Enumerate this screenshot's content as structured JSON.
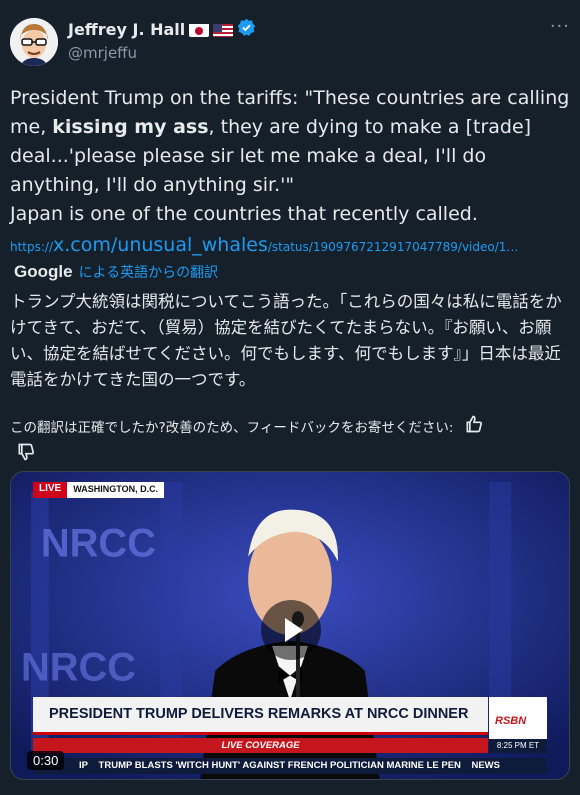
{
  "author": {
    "name": "Jeffrey J. Hall",
    "handle": "@mrjeffu",
    "flags": [
      "japan-flag",
      "usa-flag"
    ],
    "verified": true
  },
  "tweet": {
    "text_before_bold": "President Trump on the tariffs: \"These countries are calling me, ",
    "bold": "kissing my ass",
    "text_after_bold": ", they are dying to make a [trade] deal...'please please sir let me make a deal, I'll do anything, I'll do anything sir.'\"",
    "line2": "Japan is one of the countries that recently called.",
    "link_prefix": "https://",
    "link_main": "x.com/unusual_whales",
    "link_suffix": "/status/1909767212917047789/video/1…"
  },
  "translation": {
    "provider": "Google",
    "by_label": "による英語からの翻訳",
    "text": "トランプ大統領は関税についてこう語った。「これらの国々は私に電話をかけてきて、おだて、（貿易）協定を結びたくてたまらない。『お願い、お願い、協定を結ばせてください。何でもします、何でもします』」日本は最近電話をかけてきた国の一つです。",
    "feedback_prompt": "この翻訳は正確でしたか?改善のため、フィードバックをお寄せください:"
  },
  "video": {
    "live_label": "LIVE",
    "location": "WASHINGTON, D.C.",
    "headline": "PRESIDENT TRUMP DELIVERS REMARKS AT NRCC DINNER",
    "live_coverage": "LIVE COVERAGE",
    "network": "RSBN",
    "time": "8:25 PM ET",
    "ticker_start": "IP",
    "ticker": "TRUMP BLASTS 'WITCH HUNT' AGAINST FRENCH POLITICIAN MARINE LE PEN",
    "ticker_end": "NEWS",
    "duration": "0:30",
    "backdrop_text": "NRCC"
  },
  "colors": {
    "background": "#15202b",
    "text": "#e7e9ea",
    "secondary": "#8b98a5",
    "link": "#1d9bf0",
    "verified": "#1d9bf0"
  }
}
